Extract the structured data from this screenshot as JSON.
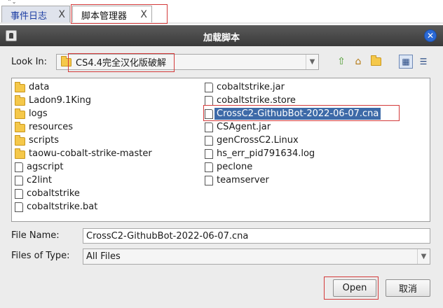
{
  "tabs": [
    {
      "label": "事件日志",
      "close": "X"
    },
    {
      "label": "脚本管理器",
      "close": "X"
    }
  ],
  "dialog": {
    "title": "加载脚本",
    "look_in_label": "Look In:",
    "look_in_value": "CS4.4完全汉化版破解",
    "file_name_label": "File Name:",
    "file_name_value": "CrossC2-GithubBot-2022-06-07.cna",
    "files_of_type_label": "Files of Type:",
    "files_of_type_value": "All Files",
    "open_label": "Open",
    "cancel_label": "取消"
  },
  "files": {
    "column1": [
      {
        "name": "data",
        "type": "folder"
      },
      {
        "name": "Ladon9.1King",
        "type": "folder"
      },
      {
        "name": "logs",
        "type": "folder"
      },
      {
        "name": "resources",
        "type": "folder"
      },
      {
        "name": "scripts",
        "type": "folder"
      },
      {
        "name": "taowu-cobalt-strike-master",
        "type": "folder"
      },
      {
        "name": "agscript",
        "type": "file"
      },
      {
        "name": "c2lint",
        "type": "file"
      },
      {
        "name": "cobaltstrike",
        "type": "file"
      },
      {
        "name": "cobaltstrike.bat",
        "type": "file"
      }
    ],
    "column2": [
      {
        "name": "cobaltstrike.jar",
        "type": "file"
      },
      {
        "name": "cobaltstrike.store",
        "type": "file"
      },
      {
        "name": "CrossC2-GithubBot-2022-06-07.cna",
        "type": "file",
        "selected": true
      },
      {
        "name": "CSAgent.jar",
        "type": "file"
      },
      {
        "name": "genCrossC2.Linux",
        "type": "file"
      },
      {
        "name": "hs_err_pid791634.log",
        "type": "file"
      },
      {
        "name": "peclone",
        "type": "file"
      },
      {
        "name": "teamserver",
        "type": "file"
      }
    ]
  },
  "colors": {
    "selection": "#3d6aa8",
    "highlight_box": "#d33a3a",
    "titlebar": "#3a3a3a"
  }
}
